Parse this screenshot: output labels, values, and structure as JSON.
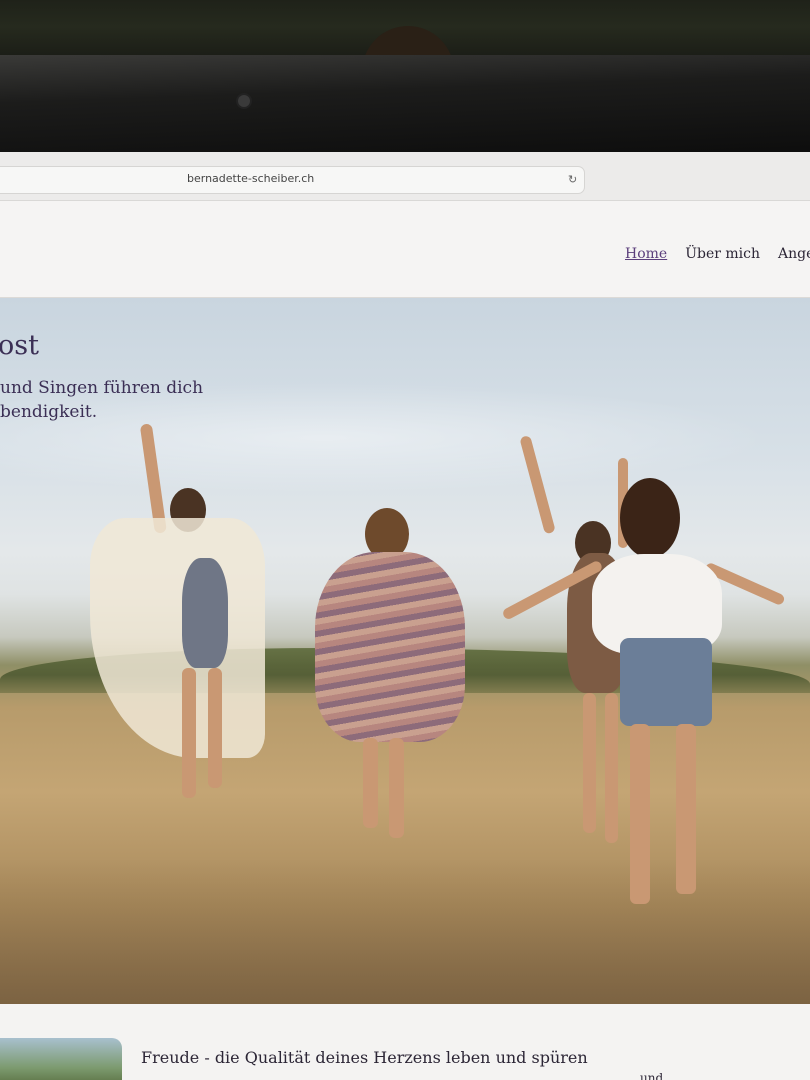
{
  "browser": {
    "url": "bernadette-scheiber.ch"
  },
  "nav": {
    "items": [
      "Home",
      "Über mich",
      "Ange"
    ]
  },
  "hero": {
    "title": "ost",
    "subtitle_line1": "und Singen führen dich",
    "subtitle_line2": "bendigkeit."
  },
  "content": {
    "section_title": "Freude - die Qualität deines Herzens leben und spüren",
    "fragment": "und"
  },
  "colors": {
    "accent": "#5b3f7c",
    "text": "#3b2f55"
  },
  "icons": {
    "reload": "reload-icon"
  }
}
